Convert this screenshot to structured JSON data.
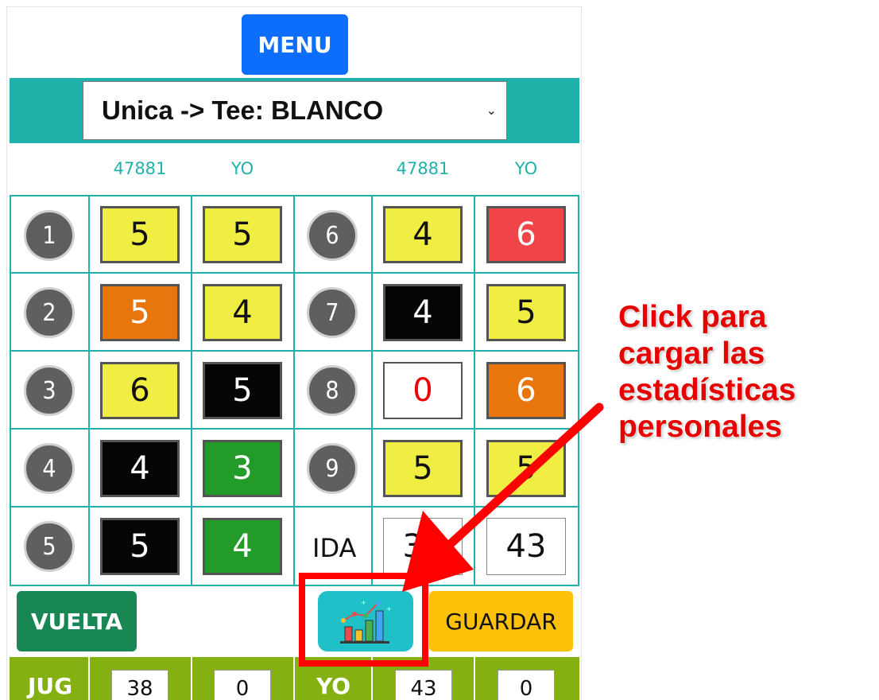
{
  "menu": {
    "label": "MENU"
  },
  "tee_select": {
    "value": "Unica -> Tee: BLANCO"
  },
  "headers": {
    "left_player": "47881",
    "left_me": "YO",
    "right_player": "47881",
    "right_me": "YO"
  },
  "front_nine": {
    "holes": [
      {
        "hole": "1",
        "player": "5",
        "player_color": "yellow",
        "me": "5",
        "me_color": "yellow"
      },
      {
        "hole": "2",
        "player": "5",
        "player_color": "orange",
        "me": "4",
        "me_color": "yellow"
      },
      {
        "hole": "3",
        "player": "6",
        "player_color": "yellow",
        "me": "5",
        "me_color": "black"
      },
      {
        "hole": "4",
        "player": "4",
        "player_color": "black",
        "me": "3",
        "me_color": "green"
      },
      {
        "hole": "5",
        "player": "5",
        "player_color": "black",
        "me": "4",
        "me_color": "green"
      }
    ],
    "holes_right": [
      {
        "hole": "6",
        "player": "4",
        "player_color": "yellow",
        "me": "6",
        "me_color": "red"
      },
      {
        "hole": "7",
        "player": "4",
        "player_color": "black",
        "me": "5",
        "me_color": "yellow"
      },
      {
        "hole": "8",
        "player": "0",
        "player_color": "white",
        "me": "6",
        "me_color": "orange"
      },
      {
        "hole": "9",
        "player": "5",
        "player_color": "yellow",
        "me": "5",
        "me_color": "yellow"
      }
    ],
    "total_label": "IDA",
    "total_player": "38",
    "total_me": "43"
  },
  "buttons": {
    "vuelta": "VUELTA",
    "stats_icon": "bar-chart-stats-icon",
    "guardar": "GUARDAR"
  },
  "footer": {
    "jug_label": "JUG",
    "jug_value": "38",
    "jug_extra": "0",
    "yo_label": "YO",
    "yo_value": "43",
    "yo_extra": "0"
  },
  "annotation": {
    "lines": [
      "Click para",
      "cargar las",
      "estadísticas",
      "personales"
    ]
  },
  "colors": {
    "teal": "#20b2aa",
    "menu_blue": "#0d6efd",
    "vuelta_green": "#198754",
    "guardar_yellow": "#ffc107",
    "footer_green": "#84b012",
    "annotation_red": "#e60000"
  }
}
